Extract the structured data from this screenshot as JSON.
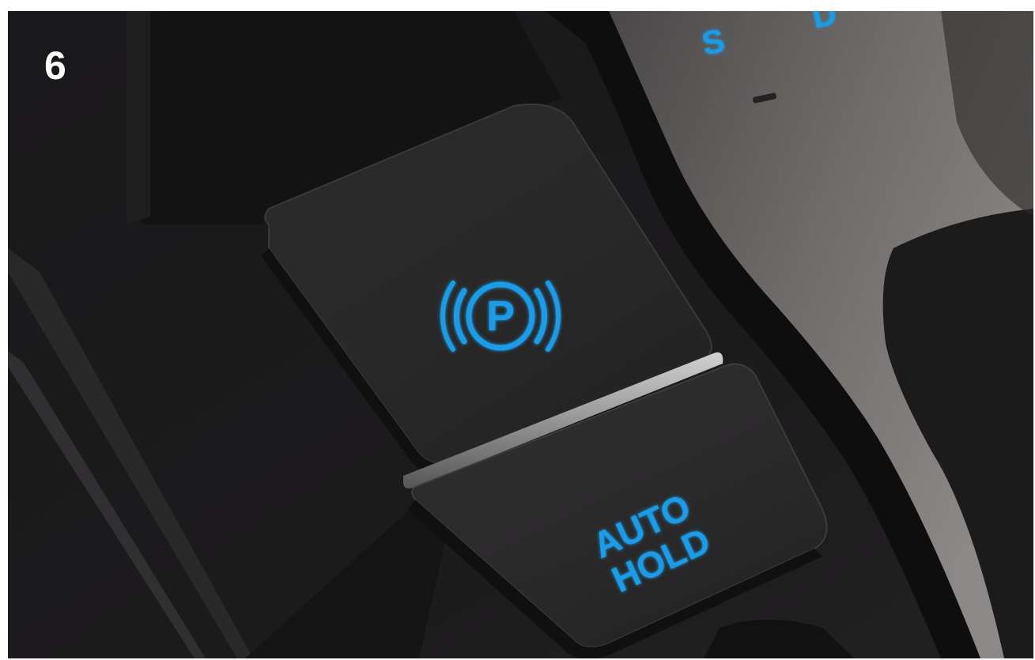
{
  "figure": {
    "step_number": "6",
    "shifter_letters": [
      "S",
      "D"
    ],
    "shifter_minus": "–"
  },
  "buttons": {
    "parking_brake": {
      "icon_label": "P",
      "icon_name": "electronic-parking-brake-icon"
    },
    "auto_hold": {
      "line1": "AUTO",
      "line2": "HOLD"
    }
  },
  "colors": {
    "illumination_blue": "#1f9be6",
    "console_dark": "#1b1a1b",
    "chrome_strip": "#9a9a9a",
    "step_number_text": "#ffffff"
  }
}
